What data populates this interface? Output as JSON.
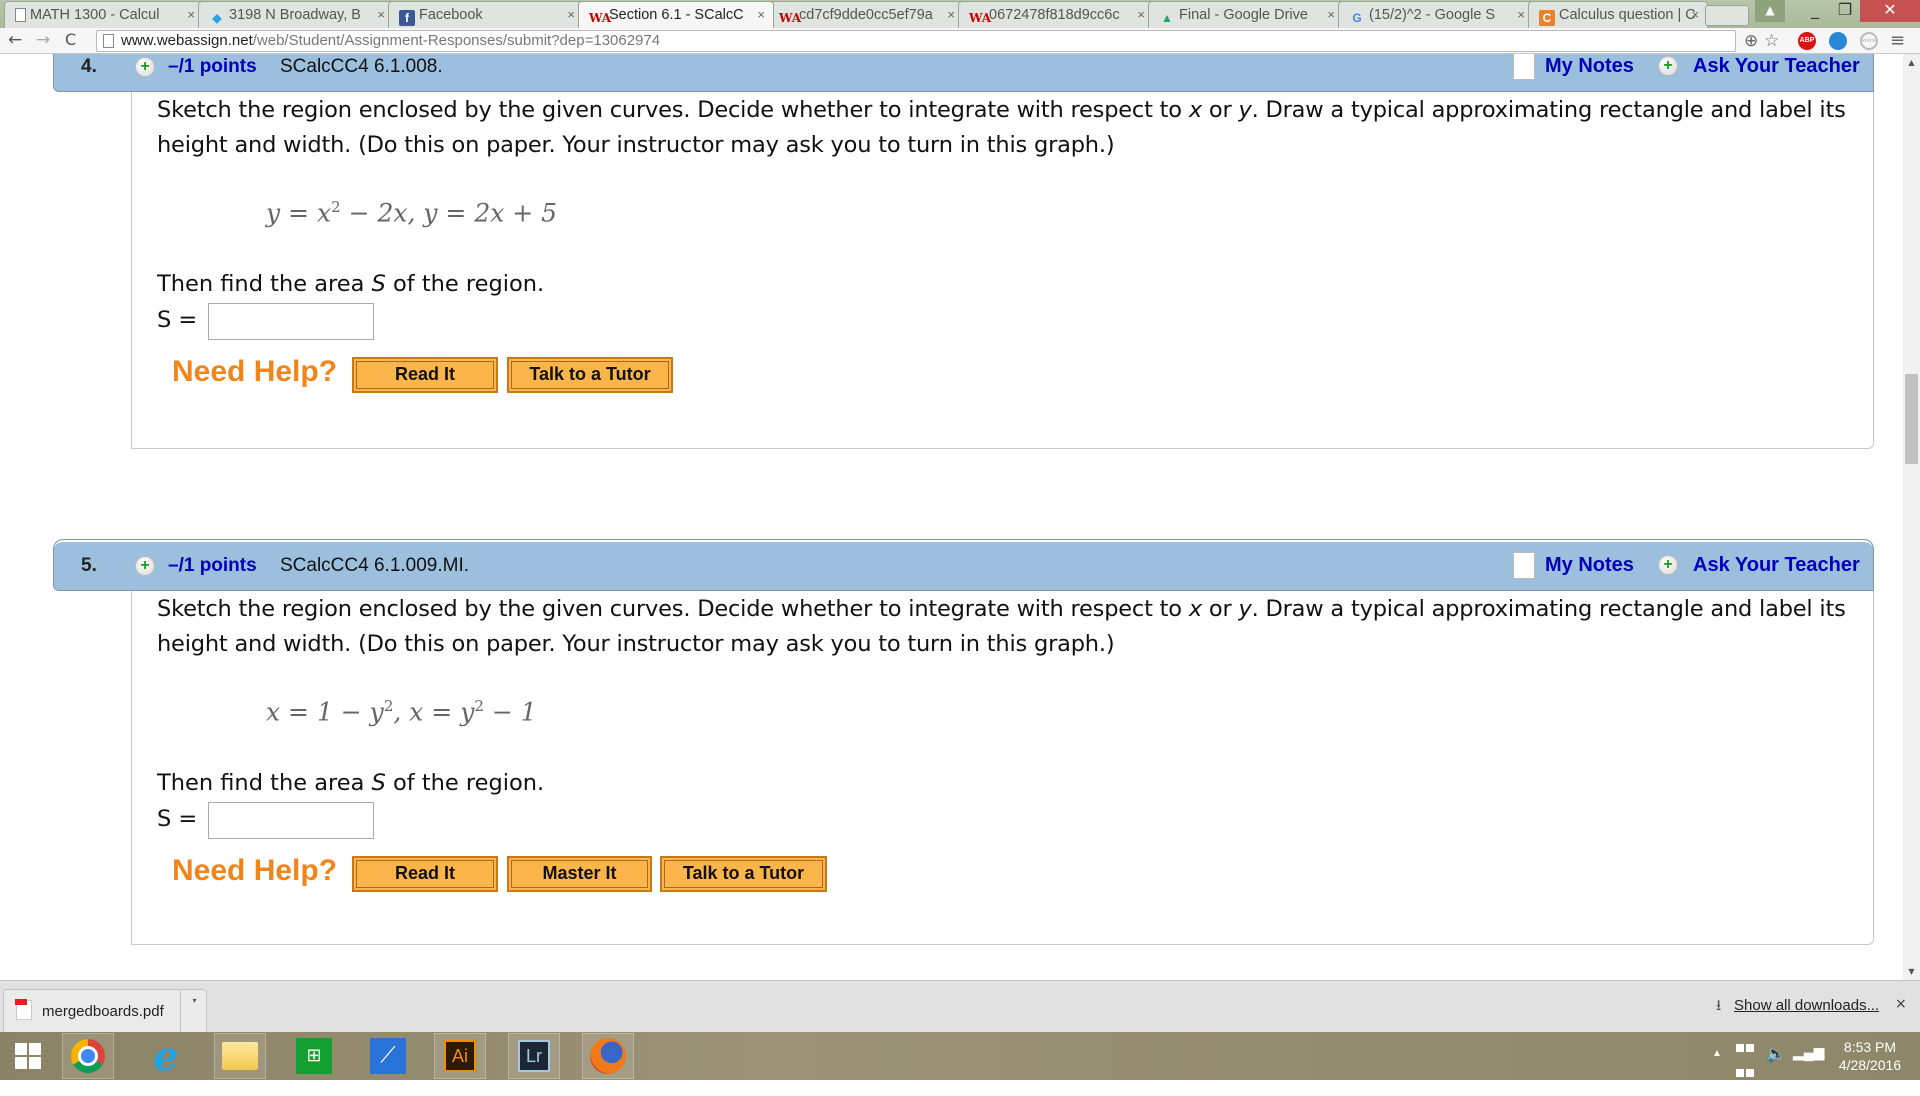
{
  "browser": {
    "tabs": [
      {
        "title": "MATH 1300 - Calcul",
        "icon": "document-icon",
        "active": false
      },
      {
        "title": "3198 N Broadway, B",
        "icon": "maps-icon",
        "active": false
      },
      {
        "title": "Facebook",
        "icon": "facebook-icon",
        "active": false
      },
      {
        "title": "Section 6.1 - SCalcC",
        "icon": "webassign-icon",
        "active": true
      },
      {
        "title": "cd7cf9dde0cc5ef79a",
        "icon": "webassign-icon",
        "active": false
      },
      {
        "title": "0672478f818d9cc6c",
        "icon": "webassign-icon",
        "active": false
      },
      {
        "title": "Final - Google Drive",
        "icon": "google-drive-icon",
        "active": false
      },
      {
        "title": "(15/2)^2 - Google S",
        "icon": "google-icon",
        "active": false
      },
      {
        "title": "Calculus question | C",
        "icon": "chegg-icon",
        "active": false
      }
    ],
    "tab_close_glyph": "×",
    "url_host": "www.webassign.net",
    "url_path": "/web/Student/Assignment-Responses/submit?dep=13062974",
    "nav": {
      "back": "←",
      "forward": "→",
      "reload": "C"
    },
    "window_controls": {
      "user": "▲",
      "minimize": "_",
      "maximize": "❐",
      "close": "✕"
    },
    "toolbar_icons": {
      "zoom": "⊕",
      "star": "☆",
      "abp": "ABP",
      "www": "www",
      "menu": "≡"
    }
  },
  "questions": [
    {
      "number": "4.",
      "points": "–/1 points",
      "code": "SCalcCC4 6.1.008.",
      "my_notes": "My Notes",
      "ask_teacher": "Ask Your Teacher",
      "prompt_parts": [
        "Sketch the region enclosed by the given curves. Decide whether to integrate with respect to ",
        "x",
        " or ",
        "y",
        ". Draw a typical approximating rectangle and label its height and width. (Do this on paper. Your instructor may ask you to turn in this graph.)"
      ],
      "equation": {
        "a": "y = x",
        "a_sup": "2",
        "b": " − 2x, y = 2x + 5",
        "b_sup": "",
        "c": ""
      },
      "then_text_a": "Then find the area ",
      "then_var": "S",
      "then_text_b": " of the region.",
      "answer_label": "S =",
      "answer_value": "",
      "need_help": "Need Help?",
      "help_buttons": [
        "Read It",
        "Talk to a Tutor"
      ]
    },
    {
      "number": "5.",
      "points": "–/1 points",
      "code": "SCalcCC4 6.1.009.MI.",
      "my_notes": "My Notes",
      "ask_teacher": "Ask Your Teacher",
      "prompt_parts": [
        "Sketch the region enclosed by the given curves. Decide whether to integrate with respect to ",
        "x",
        " or ",
        "y",
        ". Draw a typical approximating rectangle and label its height and width. (Do this on paper. Your instructor may ask you to turn in this graph.)"
      ],
      "equation": {
        "a": "x = 1 − y",
        "a_sup": "2",
        "b": ", x = y",
        "b_sup": "2",
        "c": " − 1"
      },
      "then_text_a": "Then find the area ",
      "then_var": "S",
      "then_text_b": " of the region.",
      "answer_label": "S =",
      "answer_value": "",
      "need_help": "Need Help?",
      "help_buttons": [
        "Read It",
        "Master It",
        "Talk to a Tutor"
      ]
    }
  ],
  "downloads": {
    "file_name": "mergedboards.pdf",
    "show_all": "Show all downloads...",
    "close": "×",
    "dropdown": "▾",
    "download_icon": "⭳"
  },
  "taskbar": {
    "apps": [
      "Start",
      "Google Chrome",
      "Internet Explorer",
      "File Explorer",
      "Windows Store",
      "Scanner",
      "Adobe Illustrator",
      "Adobe Lightroom",
      "Mozilla Firefox"
    ],
    "ai_label": "Ai",
    "lr_label": "Lr",
    "ie_label": "e",
    "time": "8:53 PM",
    "date": "4/28/2016",
    "tray_up": "▲",
    "volume": "🔈",
    "signal": "▂▄▆"
  },
  "scrollbar": {
    "up": "▲",
    "down": "▼",
    "position_fraction": 0.36
  }
}
